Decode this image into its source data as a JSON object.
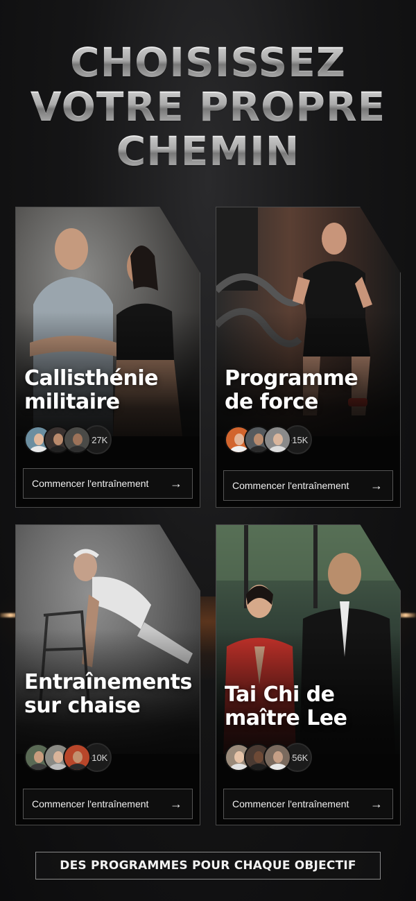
{
  "headline": {
    "line1": "CHOISISSEZ",
    "line2": "VOTRE PROPRE",
    "line3": "CHEMIN"
  },
  "cards": [
    {
      "title": "Callisthénie\nmilitaire",
      "count": "+27K",
      "cta": "Commencer l'entraînement"
    },
    {
      "title": "Programme\nde force",
      "count": "+15K",
      "cta": "Commencer l'entraînement"
    },
    {
      "title": "Entraînements\nsur chaise",
      "count": "+10K",
      "cta": "Commencer l'entraînement"
    },
    {
      "title": "Tai Chi de\nmaître Lee",
      "count": "+56K",
      "cta": "Commencer l'entraînement"
    }
  ],
  "footer": {
    "label": "DES PROGRAMMES POUR CHAQUE OBJECTIF"
  },
  "icons": {
    "cta_icon": "arrow-right-icon"
  },
  "colors": {
    "accent_glow": "#e07a2e",
    "background": "#111112"
  }
}
